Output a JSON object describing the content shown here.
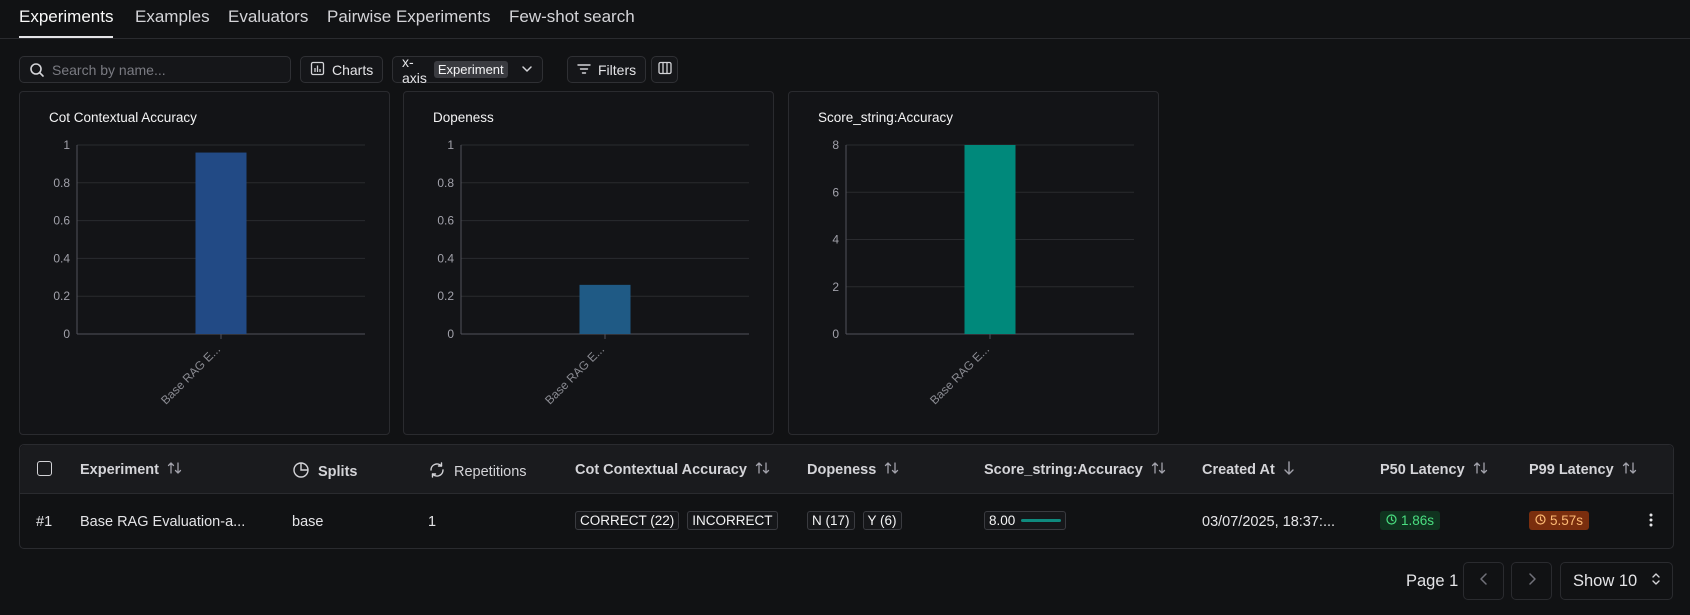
{
  "tabs": [
    {
      "label": "Experiments",
      "active": true
    },
    {
      "label": "Examples"
    },
    {
      "label": "Evaluators"
    },
    {
      "label": "Pairwise Experiments"
    },
    {
      "label": "Few-shot search"
    }
  ],
  "toolbar": {
    "search_placeholder": "Search by name...",
    "charts_label": "Charts",
    "xaxis_label": "x-axis",
    "xaxis_value": "Experiment",
    "filters_label": "Filters"
  },
  "chart_data": [
    {
      "type": "bar",
      "title": "Cot Contextual Accuracy",
      "categories": [
        "Base RAG E..."
      ],
      "values": [
        0.96
      ],
      "ylim": [
        0,
        1
      ],
      "yticks": [
        "0",
        "0.2",
        "0.4",
        "0.6",
        "0.8",
        "1"
      ],
      "ytick_values": [
        0,
        0.2,
        0.4,
        0.6,
        0.8,
        1
      ],
      "color": "#224a85",
      "grid": true
    },
    {
      "type": "bar",
      "title": "Dopeness",
      "categories": [
        "Base RAG E..."
      ],
      "values": [
        0.26
      ],
      "ylim": [
        0,
        1
      ],
      "yticks": [
        "0",
        "0.2",
        "0.4",
        "0.6",
        "0.8",
        "1"
      ],
      "ytick_values": [
        0,
        0.2,
        0.4,
        0.6,
        0.8,
        1
      ],
      "color": "#1f5a85",
      "grid": true
    },
    {
      "type": "bar",
      "title": "Score_string:Accuracy",
      "categories": [
        "Base RAG E..."
      ],
      "values": [
        8
      ],
      "ylim": [
        0,
        8
      ],
      "yticks": [
        "0",
        "2",
        "4",
        "6",
        "8"
      ],
      "ytick_values": [
        0,
        2,
        4,
        6,
        8
      ],
      "color": "#00897b",
      "grid": true
    }
  ],
  "table": {
    "headers": {
      "experiment": "Experiment",
      "splits": "Splits",
      "repetitions": "Repetitions",
      "cot": "Cot Contextual Accuracy",
      "dopeness": "Dopeness",
      "score": "Score_string:Accuracy",
      "created": "Created At",
      "p50": "P50 Latency",
      "p99": "P99 Latency"
    },
    "row": {
      "index": "#1",
      "experiment": "Base RAG Evaluation-a...",
      "splits": "base",
      "repetitions": "1",
      "cot_correct": "CORRECT (22)",
      "cot_incorrect": "INCORRECT",
      "dopeness_n": "N (17)",
      "dopeness_y": "Y (6)",
      "score": "8.00",
      "created": "03/07/2025, 18:37:...",
      "p50": "1.86s",
      "p99": "5.57s"
    }
  },
  "pagination": {
    "page_label": "Page 1",
    "show_label": "Show 10"
  }
}
